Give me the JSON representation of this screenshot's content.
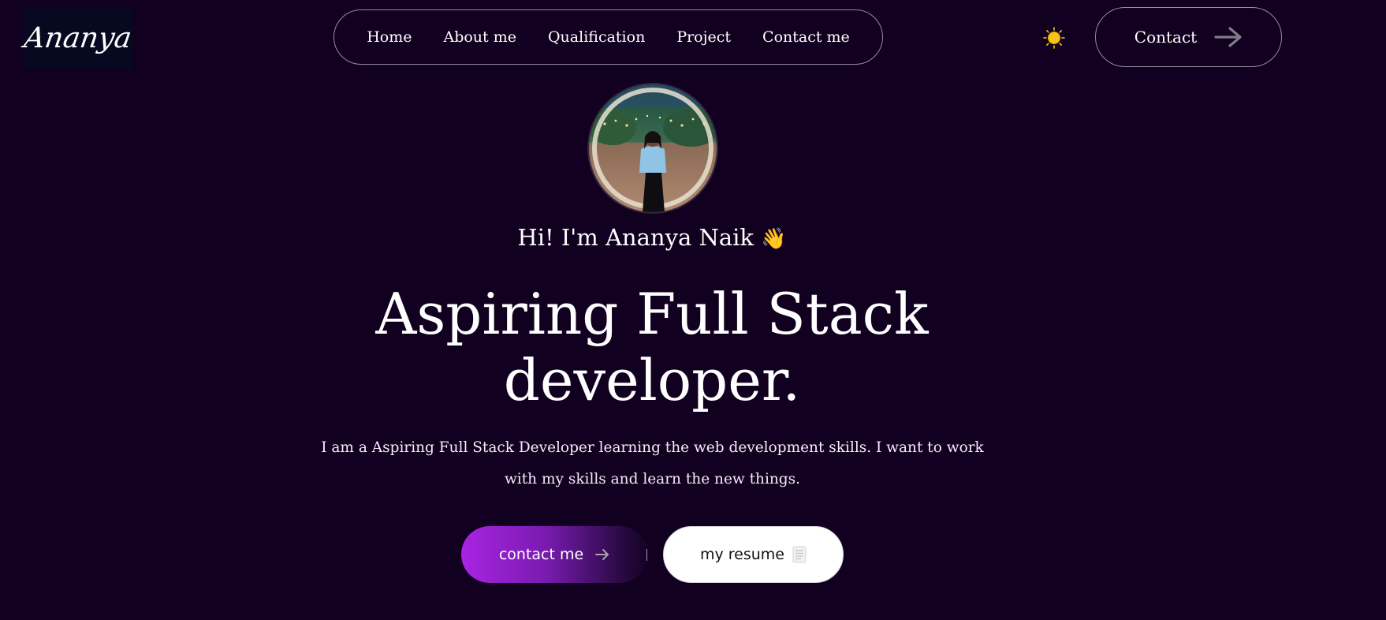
{
  "logo": {
    "text": "Ananya"
  },
  "nav": {
    "items": [
      {
        "label": "Home"
      },
      {
        "label": "About me"
      },
      {
        "label": "Qualification"
      },
      {
        "label": "Project"
      },
      {
        "label": "Contact me"
      }
    ]
  },
  "header": {
    "theme_icon": "sun-icon",
    "contact_label": "Contact",
    "contact_icon": "arrow-right-icon"
  },
  "hero": {
    "avatar_icon": "profile-photo",
    "greeting": "Hi! I'm Ananya Naik",
    "greeting_emoji": "👋",
    "headline_line1": "Aspiring Full Stack",
    "headline_line2": "developer.",
    "description": "I am a Aspiring Full Stack Developer learning the web development skills. I want to work with my skills and learn the new things.",
    "contact_button": "contact me",
    "resume_button": "my resume",
    "resume_icon": "document-icon"
  },
  "colors": {
    "background": "#11001f",
    "accent": "#a824e2",
    "sun": "#f7c21b"
  }
}
